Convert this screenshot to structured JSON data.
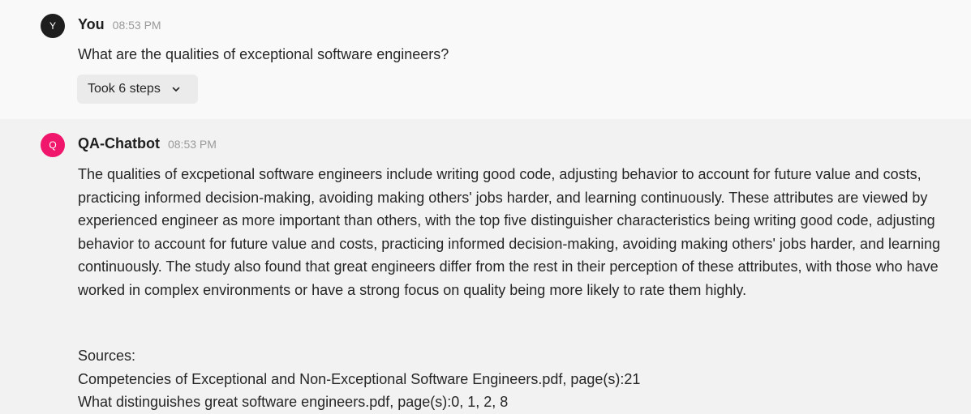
{
  "user_message": {
    "avatar_letter": "Y",
    "author": "You",
    "time": "08:53 PM",
    "text": "What are the qualities of exceptional software engineers?",
    "steps_label": "Took 6 steps"
  },
  "bot_message": {
    "avatar_letter": "Q",
    "author": "QA-Chatbot",
    "time": "08:53 PM",
    "answer": "The qualities of excpetional software engineers include writing good code, adjusting behavior to account for future value and costs, practicing informed decision-making, avoiding making others' jobs harder, and learning continuously. These attributes are viewed by experienced engineer as more important than others, with the top five distinguisher characteristics being writing good code, adjusting behavior to account for future value and costs, practicing informed decision-making, avoiding making others' jobs harder, and learning continuously. The study also found that great engineers differ from the rest in their perception of these attributes, with those who have worked in complex environments or have a strong focus on quality being more likely to rate them highly.",
    "sources_label": "Sources:",
    "sources": [
      "Competencies of Exceptional and Non-Exceptional Software Engineers.pdf, page(s):21",
      "What distinguishes great software engineers.pdf, page(s):0, 1, 2, 8"
    ]
  },
  "colors": {
    "user_avatar": "#1e1e1e",
    "bot_avatar": "#f0166b",
    "user_bg": "#f9f9f9",
    "bot_bg": "#f2f2f2"
  },
  "icons": {
    "steps_toggle": "chevron-down-icon"
  }
}
